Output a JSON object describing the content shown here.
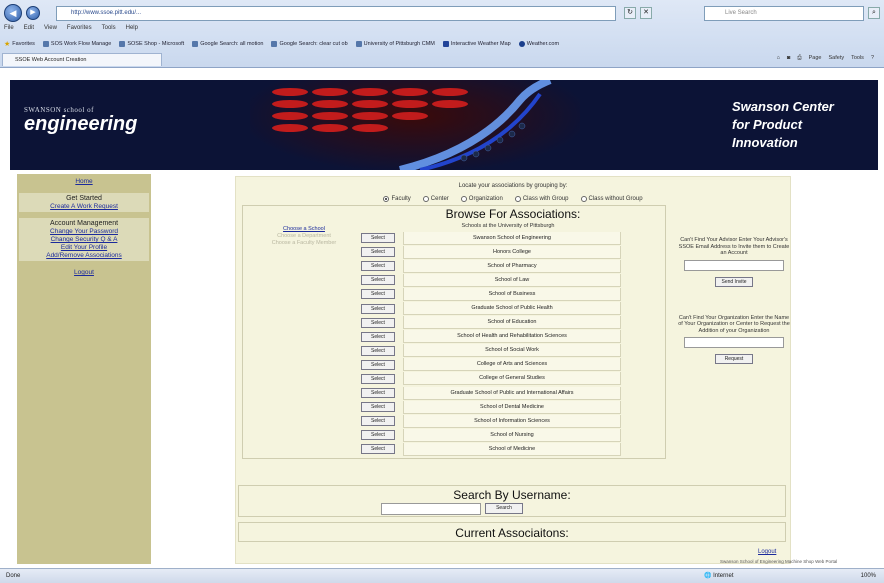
{
  "browser": {
    "address": "http://www.ssoe.pitt.edu/...",
    "search_placeholder": "Live Search",
    "menu": [
      "File",
      "Edit",
      "View",
      "Favorites",
      "Tools",
      "Help"
    ],
    "favorites_label": "Favorites",
    "favorites": [
      "SOS Work Flow Manage",
      "SOSE Shop - Microsoft",
      "Google Search: all motion",
      "Google Search: clear cut ob",
      "University of Pittsburgh CMM",
      "Interactive Weather Map",
      "Weather.com"
    ],
    "tab_title": "SSOE Web Account Creation",
    "commands": [
      "Page",
      "Safety",
      "Tools"
    ],
    "status_left": "Done",
    "status_zone": "Internet",
    "status_zoom": "100%"
  },
  "banner": {
    "logo_sub": "SWANSON school of",
    "logo_main": "engineering",
    "center_line1": "Swanson Center",
    "center_line2": "for Product",
    "center_line3": "Innovation"
  },
  "sidebar": {
    "home": "Home",
    "get_started": "Get Started",
    "create_request": "Create A Work Request",
    "account_mgmt": "Account Management",
    "change_password": "Change Your Password",
    "change_security": "Change Security Q & A",
    "edit_profile": "Edit Your Profile",
    "add_remove": "Add/Remove Associations",
    "logout": "Logout"
  },
  "main": {
    "locate_text": "Locate your associations by grouping by:",
    "radios": [
      {
        "label": "Faculty",
        "checked": true
      },
      {
        "label": "Center",
        "checked": false
      },
      {
        "label": "Organization",
        "checked": false
      },
      {
        "label": "Class with Group",
        "checked": false
      },
      {
        "label": "Class without Group",
        "checked": false
      }
    ],
    "browse_title": "Browse For Associations:",
    "choose_school": "Choose a School",
    "choose_department": "Choose a Department",
    "choose_faculty": "Choose a Faculty Member",
    "schools_caption": "Schools at the University of Pittsburgh",
    "select_label": "Select",
    "schools": [
      "Swanson School of Engineering",
      "Honors College",
      "School of Pharmacy",
      "School of Law",
      "School of Business",
      "Graduate School of Public Health",
      "School of Education",
      "School of Health and Rehabilitation Sciences",
      "School of Social Work",
      "College of Arts and Sciences",
      "College of General Studies",
      "Graduate School of Public and International Affairs",
      "School of Dental Medicine",
      "School of Information Sciences",
      "School of Nursing",
      "School of Medicine"
    ],
    "advisor_text": "Can't Find Your Advisor Enter Your Advisor's SSOE Email Address to Invite them to Create an Account",
    "send_invite": "Send Invite",
    "org_text": "Can't Find Your Organization Enter the Name of Your Organization or Center to Request the Addition of your Organization",
    "request_label": "Request",
    "search_title": "Search By Username:",
    "search_button": "Search",
    "current_title": "Current Associaitons:",
    "logout": "Logout",
    "footer_note": "Swanson School of Engineering Machine Shop Web Portal"
  }
}
